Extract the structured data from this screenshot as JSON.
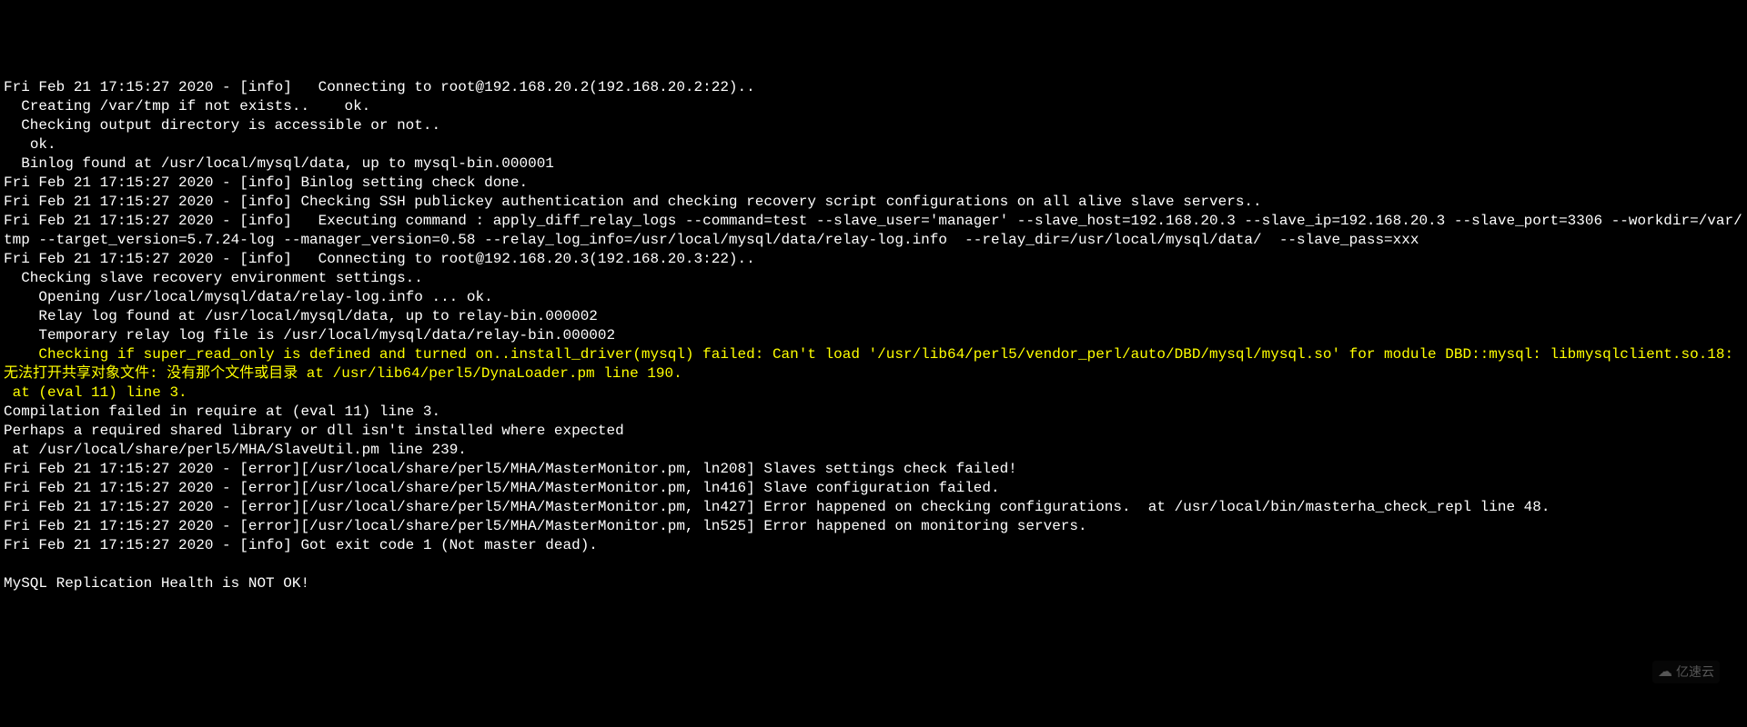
{
  "segments": [
    {
      "text": "Fri Feb 21 17:15:27 2020 - [info]   Connecting to root@192.168.20.2(192.168.20.2:22)..\n  Creating /var/tmp if not exists..    ok.\n  Checking output directory is accessible or not..\n   ok.\n  Binlog found at /usr/local/mysql/data, up to mysql-bin.000001\nFri Feb 21 17:15:27 2020 - [info] Binlog setting check done.\nFri Feb 21 17:15:27 2020 - [info] Checking SSH publickey authentication and checking recovery script configurations on all alive slave servers..\nFri Feb 21 17:15:27 2020 - [info]   Executing command : apply_diff_relay_logs --command=test --slave_user='manager' --slave_host=192.168.20.3 --slave_ip=192.168.20.3 --slave_port=3306 --workdir=/var/tmp --target_version=5.7.24-log --manager_version=0.58 --relay_log_info=/usr/local/mysql/data/relay-log.info  --relay_dir=/usr/local/mysql/data/  --slave_pass=xxx\nFri Feb 21 17:15:27 2020 - [info]   Connecting to root@192.168.20.3(192.168.20.3:22)..\n  Checking slave recovery environment settings..\n    Opening /usr/local/mysql/data/relay-log.info ... ok.\n    Relay log found at /usr/local/mysql/data, up to relay-bin.000002\n    Temporary relay log file is /usr/local/mysql/data/relay-bin.000002\n    ",
      "highlight": false
    },
    {
      "text": "Checking if super_read_only is defined and turned on..install_driver(mysql) failed: Can't load '/usr/lib64/perl5/vendor_perl/auto/DBD/mysql/mysql.so' for module DBD::mysql: libmysqlclient.so.18: 无法打开共享对象文件: 没有那个文件或目录 at /usr/lib64/perl5/DynaLoader.pm line 190.\n at (eval 11) line 3.",
      "highlight": true
    },
    {
      "text": "\nCompilation failed in require at (eval 11) line 3.\nPerhaps a required shared library or dll isn't installed where expected\n at /usr/local/share/perl5/MHA/SlaveUtil.pm line 239.\nFri Feb 21 17:15:27 2020 - [error][/usr/local/share/perl5/MHA/MasterMonitor.pm, ln208] Slaves settings check failed!\nFri Feb 21 17:15:27 2020 - [error][/usr/local/share/perl5/MHA/MasterMonitor.pm, ln416] Slave configuration failed.\nFri Feb 21 17:15:27 2020 - [error][/usr/local/share/perl5/MHA/MasterMonitor.pm, ln427] Error happened on checking configurations.  at /usr/local/bin/masterha_check_repl line 48.\nFri Feb 21 17:15:27 2020 - [error][/usr/local/share/perl5/MHA/MasterMonitor.pm, ln525] Error happened on monitoring servers.\nFri Feb 21 17:15:27 2020 - [info] Got exit code 1 (Not master dead).\n\nMySQL Replication Health is NOT OK!",
      "highlight": false
    }
  ],
  "watermark": {
    "icon": "ಂ",
    "text": "亿速云"
  }
}
